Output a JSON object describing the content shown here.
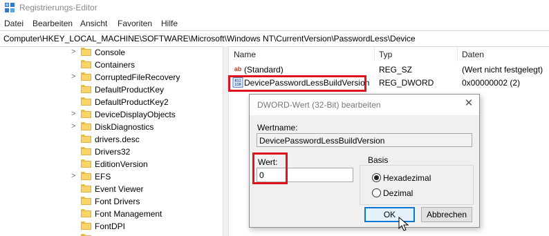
{
  "window": {
    "title": "Registrierungs-Editor",
    "icon": "regedit-icon"
  },
  "menu": [
    "Datei",
    "Bearbeiten",
    "Ansicht",
    "Favoriten",
    "Hilfe"
  ],
  "address": "Computer\\HKEY_LOCAL_MACHINE\\SOFTWARE\\Microsoft\\Windows NT\\CurrentVersion\\PasswordLess\\Device",
  "tree": {
    "items": [
      {
        "label": "Console",
        "expandable": true
      },
      {
        "label": "Containers",
        "expandable": false
      },
      {
        "label": "CorruptedFileRecovery",
        "expandable": true
      },
      {
        "label": "DefaultProductKey",
        "expandable": false
      },
      {
        "label": "DefaultProductKey2",
        "expandable": false
      },
      {
        "label": "DeviceDisplayObjects",
        "expandable": true
      },
      {
        "label": "DiskDiagnostics",
        "expandable": true
      },
      {
        "label": "drivers.desc",
        "expandable": false
      },
      {
        "label": "Drivers32",
        "expandable": false
      },
      {
        "label": "EditionVersion",
        "expandable": false
      },
      {
        "label": "EFS",
        "expandable": true
      },
      {
        "label": "Event Viewer",
        "expandable": false
      },
      {
        "label": "Font Drivers",
        "expandable": false
      },
      {
        "label": "Font Management",
        "expandable": false
      },
      {
        "label": "FontDPI",
        "expandable": false
      },
      {
        "label": "",
        "expandable": false
      }
    ]
  },
  "list": {
    "columns": [
      "Name",
      "Typ",
      "Daten"
    ],
    "rows": [
      {
        "icon": "string-value-icon",
        "icon_text": "ab",
        "name": "(Standard)",
        "type": "REG_SZ",
        "data": "(Wert nicht festgelegt)"
      },
      {
        "icon": "dword-value-icon",
        "icon_text": "011\n110",
        "name": "DevicePasswordLessBuildVersion",
        "type": "REG_DWORD",
        "data": "0x00000002 (2)"
      }
    ]
  },
  "dialog": {
    "title": "DWORD-Wert (32-Bit) bearbeiten",
    "close_glyph": "✕",
    "name_label": "Wertname:",
    "name_value": "DevicePasswordLessBuildVersion",
    "value_label": "Wert:",
    "value_value": "0",
    "basis_label": "Basis",
    "radio_hex": "Hexadezimal",
    "radio_dec": "Dezimal",
    "selected_basis": "Hexadezimal",
    "ok": "OK",
    "cancel": "Abbrechen"
  },
  "colors": {
    "highlight_red": "#e0141e",
    "focus_blue": "#0078d7",
    "folder_yellow": "#f9d46b"
  }
}
